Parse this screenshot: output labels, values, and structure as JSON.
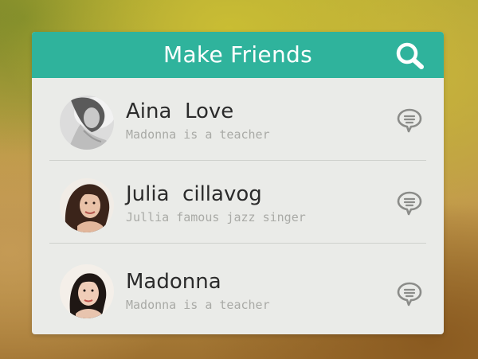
{
  "header": {
    "title": "Make Friends",
    "search_icon": "search-icon"
  },
  "contacts": [
    {
      "name": "Aina  Love",
      "subtitle": "Madonna is a teacher",
      "avatar_style": "grayscale",
      "action_icon": "chat-bubble-icon"
    },
    {
      "name": "Julia  cillavog",
      "subtitle": "Jullia famous jazz singer",
      "avatar_style": "color",
      "action_icon": "chat-bubble-icon"
    },
    {
      "name": "Madonna",
      "subtitle": "Madonna is a teacher",
      "avatar_style": "color",
      "action_icon": "chat-bubble-icon"
    }
  ],
  "colors": {
    "header_background": "#2fb39c",
    "card_background": "#eaebe8",
    "name_text": "#2b2b2b",
    "subtitle_text": "#a9aaa6",
    "icon_gray": "#8b8c89"
  }
}
